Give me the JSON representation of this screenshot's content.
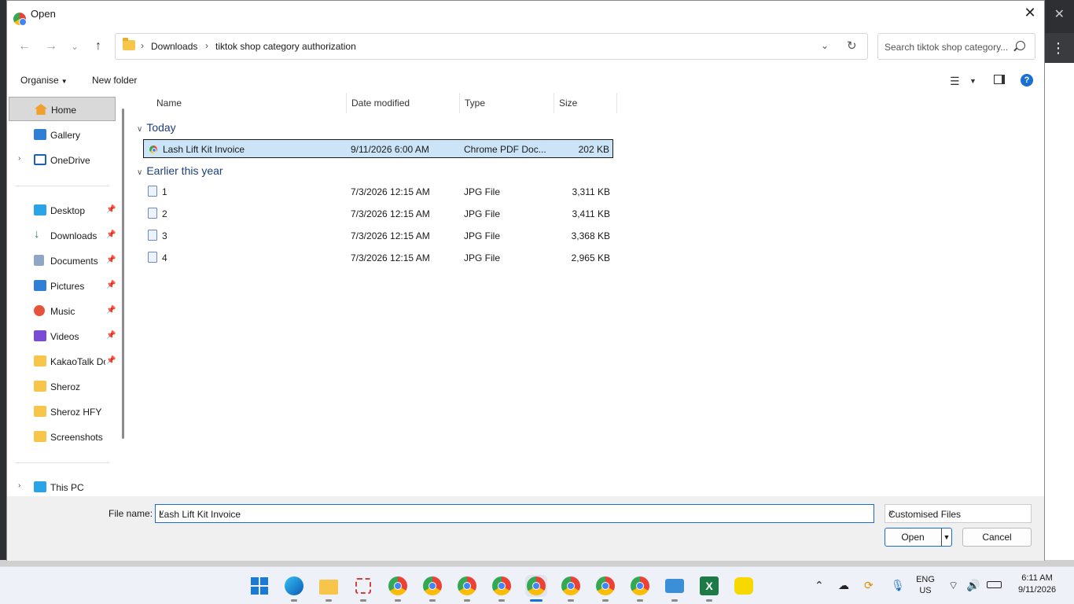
{
  "dialog": {
    "title": "Open",
    "close_glyph": "✕"
  },
  "nav": {
    "back": "←",
    "forward": "→",
    "recent": "⌄",
    "up": "↑"
  },
  "address": {
    "crumbs": [
      "Downloads",
      "tiktok shop category authorization"
    ],
    "separator": "›"
  },
  "search": {
    "placeholder": "Search tiktok shop category..."
  },
  "commands": {
    "organise": "Organise",
    "new_folder": "New folder"
  },
  "sidebar": {
    "items": [
      {
        "label": "Home"
      },
      {
        "label": "Gallery"
      },
      {
        "label": "OneDrive"
      },
      {
        "label": "Desktop"
      },
      {
        "label": "Downloads"
      },
      {
        "label": "Documents"
      },
      {
        "label": "Pictures"
      },
      {
        "label": "Music"
      },
      {
        "label": "Videos"
      },
      {
        "label": "KakaoTalk Downloads"
      },
      {
        "label": "Sheroz"
      },
      {
        "label": "Sheroz HFY"
      },
      {
        "label": "Screenshots"
      },
      {
        "label": "This PC"
      }
    ]
  },
  "columns": {
    "name": "Name",
    "date": "Date modified",
    "type": "Type",
    "size": "Size"
  },
  "groups": {
    "today": "Today",
    "earlier": "Earlier this year"
  },
  "files_today": [
    {
      "name": "Lash Lift Kit Invoice",
      "date": "9/11/2026 6:00 AM",
      "type": "Chrome PDF Doc...",
      "size": "202 KB"
    }
  ],
  "files_earlier": [
    {
      "name": "1",
      "date": "7/3/2026 12:15 AM",
      "type": "JPG File",
      "size": "3,311 KB"
    },
    {
      "name": "2",
      "date": "7/3/2026 12:15 AM",
      "type": "JPG File",
      "size": "3,411 KB"
    },
    {
      "name": "3",
      "date": "7/3/2026 12:15 AM",
      "type": "JPG File",
      "size": "3,368 KB"
    },
    {
      "name": "4",
      "date": "7/3/2026 12:15 AM",
      "type": "JPG File",
      "size": "2,965 KB"
    }
  ],
  "bottom": {
    "file_name_label": "File name:",
    "file_name_value": "Lash Lift Kit Invoice",
    "file_type": "Customised Files",
    "open": "Open",
    "cancel": "Cancel"
  },
  "tray": {
    "lang1": "ENG",
    "lang2": "US",
    "time": "6:11 AM",
    "date": "9/11/2026"
  },
  "colors": {
    "accent": "#1b6fd1",
    "selection": "#cce4f7",
    "group_heading": "#1e3e7a"
  }
}
